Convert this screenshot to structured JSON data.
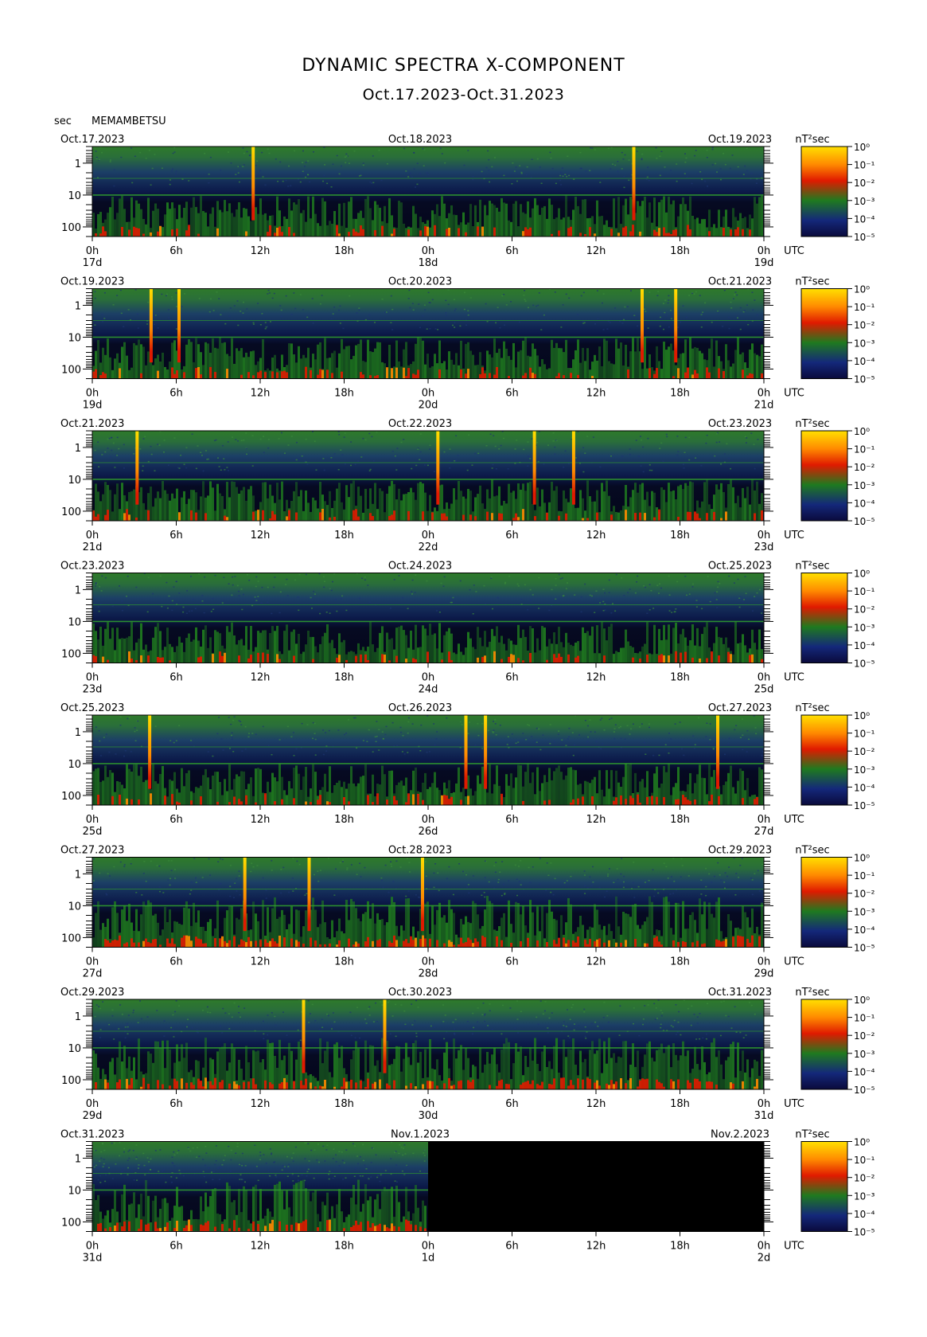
{
  "title": "DYNAMIC SPECTRA X-COMPONENT",
  "subtitle": "Oct.17.2023-Oct.31.2023",
  "y_unit": "sec",
  "station": "MEMAMBETSU",
  "utc_label": "UTC",
  "colorbar_unit": "nT²sec",
  "colorbar_ticks": [
    "10⁰",
    "10⁻¹",
    "10⁻²",
    "10⁻³",
    "10⁻⁴",
    "10⁻⁵"
  ],
  "colors": {
    "low": "#0a0a3c",
    "mid_blue": "#14287a",
    "green": "#1f7a1f",
    "red": "#e01a00",
    "orange": "#ff8a00",
    "yellow": "#ffe000",
    "no_data": "#000000"
  },
  "chart_data": {
    "type": "heatmap",
    "x_tick_labels": [
      "0h",
      "6h",
      "12h",
      "18h",
      "0h",
      "6h",
      "12h",
      "18h",
      "0h"
    ],
    "y_tick_labels": [
      "1",
      "10",
      "100"
    ],
    "y_ticks": [
      1,
      10,
      100
    ],
    "ylim": [
      0.3,
      200
    ],
    "y_scale": "log",
    "y_inverted": true,
    "color_scale": "log",
    "color_range": [
      1e-05,
      1
    ],
    "panels": [
      {
        "start_label": "Oct.17.2023",
        "mid_label": "Oct.18.2023",
        "end_label": "Oct.19.2023",
        "day_labels": [
          "17d",
          "18d",
          "19d"
        ],
        "spikes_hours": [
          11.5,
          38.7
        ],
        "data_until_hours": 48
      },
      {
        "start_label": "Oct.19.2023",
        "mid_label": "Oct.20.2023",
        "end_label": "Oct.21.2023",
        "day_labels": [
          "19d",
          "20d",
          "21d"
        ],
        "spikes_hours": [
          4.2,
          6.2,
          39.3,
          41.7
        ],
        "data_until_hours": 48
      },
      {
        "start_label": "Oct.21.2023",
        "mid_label": "Oct.22.2023",
        "end_label": "Oct.23.2023",
        "day_labels": [
          "21d",
          "22d",
          "23d"
        ],
        "spikes_hours": [
          3.2,
          24.7,
          31.6,
          34.4
        ],
        "data_until_hours": 48
      },
      {
        "start_label": "Oct.23.2023",
        "mid_label": "Oct.24.2023",
        "end_label": "Oct.25.2023",
        "day_labels": [
          "23d",
          "24d",
          "25d"
        ],
        "spikes_hours": [],
        "data_until_hours": 48
      },
      {
        "start_label": "Oct.25.2023",
        "mid_label": "Oct.26.2023",
        "end_label": "Oct.27.2023",
        "day_labels": [
          "25d",
          "26d",
          "27d"
        ],
        "spikes_hours": [
          4.1,
          26.7,
          28.1,
          44.7
        ],
        "data_until_hours": 48
      },
      {
        "start_label": "Oct.27.2023",
        "mid_label": "Oct.28.2023",
        "end_label": "Oct.29.2023",
        "day_labels": [
          "27d",
          "28d",
          "29d"
        ],
        "spikes_hours": [
          10.9,
          15.5,
          23.6
        ],
        "data_until_hours": 48
      },
      {
        "start_label": "Oct.29.2023",
        "mid_label": "Oct.30.2023",
        "end_label": "Oct.31.2023",
        "day_labels": [
          "29d",
          "30d",
          "31d"
        ],
        "spikes_hours": [
          15.1,
          20.9
        ],
        "data_until_hours": 48
      },
      {
        "start_label": "Oct.31.2023",
        "mid_label": "Nov.1.2023",
        "end_label": "Nov.2.2023",
        "day_labels": [
          "31d",
          "1d",
          "2d"
        ],
        "spikes_hours": [],
        "data_until_hours": 24
      }
    ]
  }
}
